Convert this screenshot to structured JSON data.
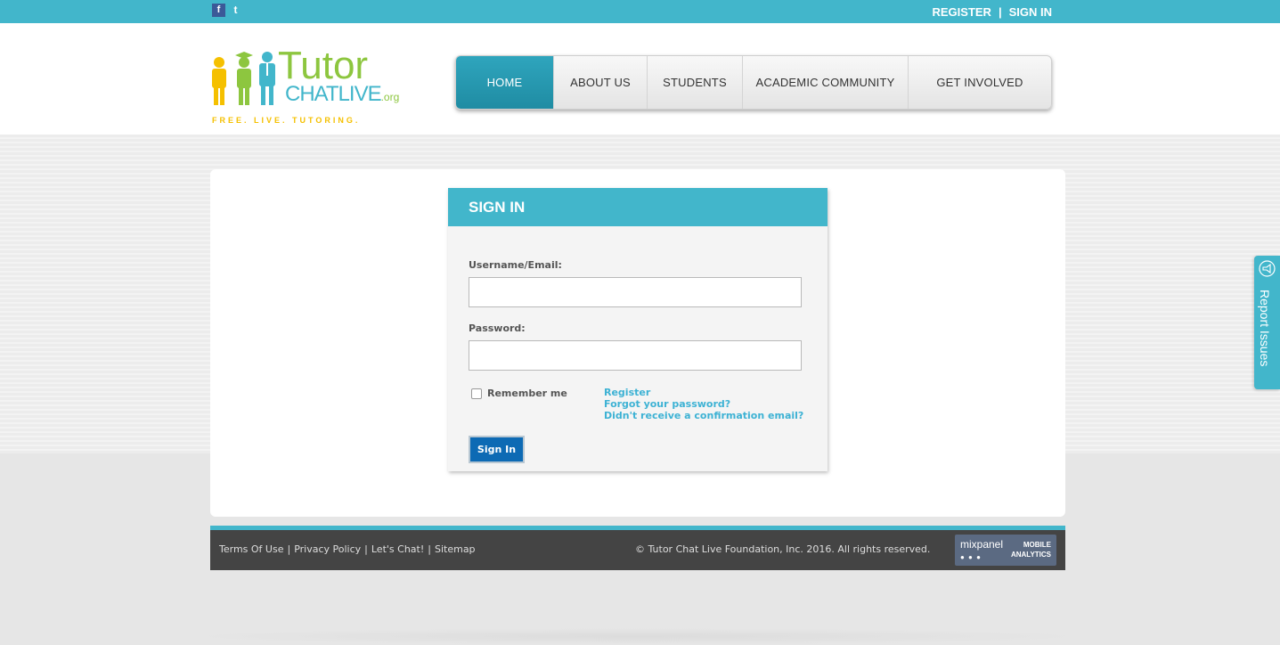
{
  "topbar": {
    "facebook_icon": "f",
    "twitter_icon": "t",
    "register": "REGISTER",
    "separator": "|",
    "signin": "SIGN IN"
  },
  "logo": {
    "word1": "Tutor",
    "word2": "CHATLIVE",
    "org": ".org",
    "tagline": "FREE. LIVE. TUTORING."
  },
  "nav": {
    "items": [
      {
        "label": "HOME",
        "active": true
      },
      {
        "label": "ABOUT US",
        "active": false
      },
      {
        "label": "STUDENTS",
        "active": false
      },
      {
        "label": "ACADEMIC COMMUNITY",
        "active": false
      },
      {
        "label": "GET INVOLVED",
        "active": false
      }
    ]
  },
  "signin": {
    "title": "SIGN IN",
    "username_label": "Username/Email:",
    "username_value": "",
    "password_label": "Password:",
    "password_value": "",
    "remember_label": "Remember me",
    "remember_checked": false,
    "link_register": "Register",
    "link_forgot": "Forgot your password?",
    "link_confirm": "Didn't receive a confirmation email?",
    "button": "Sign In"
  },
  "footer": {
    "links": [
      "Terms Of Use",
      "Privacy Policy",
      "Let's Chat!",
      "Sitemap"
    ],
    "separator": "|",
    "copyright": "© Tutor Chat Live Foundation, Inc. 2016. All rights reserved.",
    "badge_brand": "mixpanel",
    "badge_line1": "MOBILE",
    "badge_line2": "ANALYTICS"
  },
  "report_tab": {
    "label": "Report Issues",
    "icon": "megaphone-icon"
  },
  "colors": {
    "accent": "#42b6cb",
    "nav_active": "#1f8ca3",
    "button": "#0d6ab4",
    "footer": "#444444",
    "link": "#3db2d4"
  }
}
